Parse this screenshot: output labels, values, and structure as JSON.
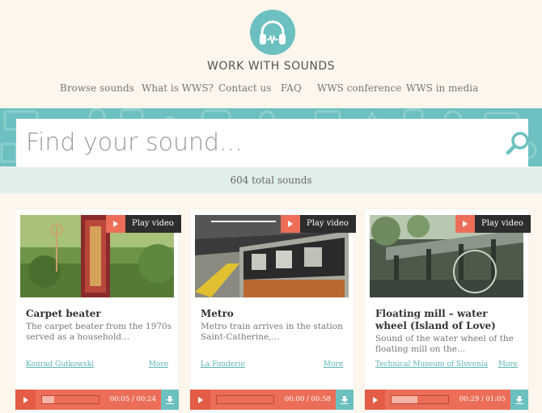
{
  "header": {
    "site_title": "WORK WITH SOUNDS",
    "logo_icon": "headphones-icon"
  },
  "nav": {
    "items": [
      {
        "label": "Browse sounds"
      },
      {
        "label": "What is WWS?"
      },
      {
        "label": "Contact us"
      },
      {
        "label": "FAQ"
      },
      {
        "label": "WWS conference"
      },
      {
        "label": "WWS in media"
      }
    ]
  },
  "search": {
    "placeholder": "Find your sound...",
    "value": "",
    "icon": "search-icon"
  },
  "results": {
    "count_text": "604 total sounds"
  },
  "cards": [
    {
      "play_label": "Play video",
      "title": "Carpet beater",
      "description": "The carpet beater from the 1970s served as a household...",
      "author": "Konrad Gutkowski",
      "more": "More",
      "time": "00:05 / 00:24",
      "progress": 0.21
    },
    {
      "play_label": "Play video",
      "title": "Metro",
      "description": "Metro train arrives in the station Saint-Catherine,...",
      "author": "La Fonderie",
      "more": "More",
      "time": "00:00 / 00:58",
      "progress": 0.0
    },
    {
      "play_label": "Play video",
      "title": "Floating mill – water wheel (Island of Love)",
      "description": "Sound of the water wheel of the floating mill on the...",
      "author": "Technical Museum of Slovenia",
      "more": "More",
      "time": "00:29 / 01:05",
      "progress": 0.45
    }
  ],
  "colors": {
    "accent_teal": "#6cc0c0",
    "accent_coral": "#ec6e58",
    "background": "#fdf6ec"
  }
}
